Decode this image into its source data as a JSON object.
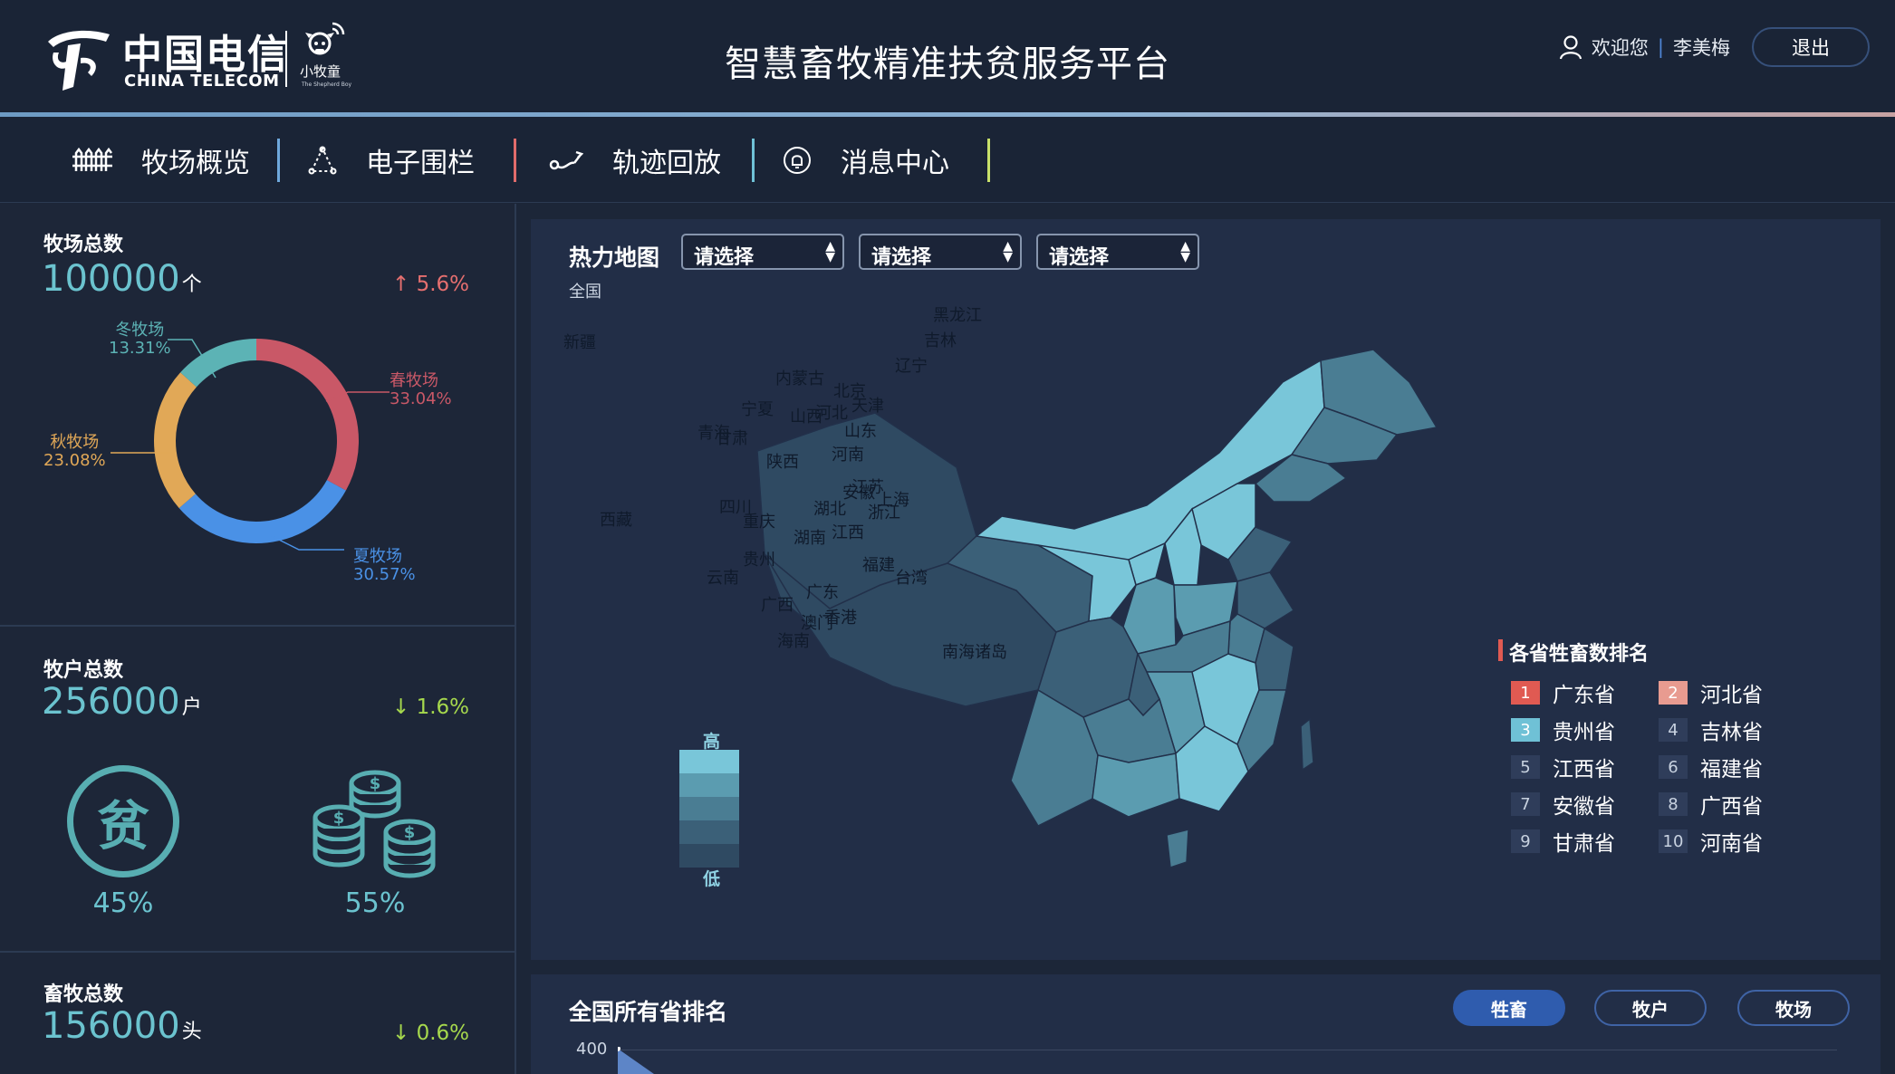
{
  "header": {
    "logo_cn": "中国电信",
    "logo_en": "CHINA TELECOM",
    "logo_sub": "小牧童",
    "logo_tiny": "The Shepherd Boy",
    "title": "智慧畜牧精准扶贫服务平台",
    "welcome": "欢迎您",
    "separator": "|",
    "username": "李美梅",
    "logout_label": "退出"
  },
  "nav": {
    "items": [
      {
        "label": "牧场概览",
        "icon": "fence-icon"
      },
      {
        "label": "电子围栏",
        "icon": "geofence-icon"
      },
      {
        "label": "轨迹回放",
        "icon": "track-icon"
      },
      {
        "label": "消息中心",
        "icon": "bell-icon"
      }
    ],
    "separator_colors": [
      "#6fa8dc",
      "#e16b6b",
      "#6fc1d6",
      "#c8e06a"
    ]
  },
  "stats": {
    "farms": {
      "label": "牧场总数",
      "value": "100000",
      "unit": "个",
      "trend_arrow": "↑",
      "trend": "5.6%",
      "trend_dir": "up",
      "segments": [
        {
          "name": "春牧场",
          "pct": "33.04%",
          "value": 33.04,
          "color": "#c95867"
        },
        {
          "name": "夏牧场",
          "pct": "30.57%",
          "value": 30.57,
          "color": "#4a91e6"
        },
        {
          "name": "秋牧场",
          "pct": "23.08%",
          "value": 23.08,
          "color": "#e1a857"
        },
        {
          "name": "冬牧场",
          "pct": "13.31%",
          "value": 13.31,
          "color": "#5cb3b5"
        }
      ]
    },
    "herders": {
      "label": "牧户总数",
      "value": "256000",
      "unit": "户",
      "trend_arrow": "↓",
      "trend": "1.6%",
      "trend_dir": "down",
      "poor_glyph": "贫",
      "poor_pct": "45%",
      "rich_pct": "55%",
      "coin_symbol": "$"
    },
    "livestock": {
      "label": "畜牧总数",
      "value": "156000",
      "unit": "头",
      "trend_arrow": "↓",
      "trend": "0.6%",
      "trend_dir": "down"
    }
  },
  "map": {
    "title": "热力地图",
    "selects": [
      "请选择",
      "请选择",
      "请选择"
    ],
    "scope": "全国",
    "legend_high": "高",
    "legend_low": "低",
    "legend_colors": [
      "#79c6d9",
      "#5b9cb0",
      "#4a7d93",
      "#3b6078",
      "#2f4a62"
    ],
    "provinces": [
      {
        "name": "黑龙江",
        "level": 2
      },
      {
        "name": "吉林",
        "level": 2
      },
      {
        "name": "辽宁",
        "level": 2
      },
      {
        "name": "内蒙古",
        "level": 0
      },
      {
        "name": "北京",
        "level": 4
      },
      {
        "name": "天津",
        "level": 4
      },
      {
        "name": "河北",
        "level": 0
      },
      {
        "name": "山西",
        "level": 0
      },
      {
        "name": "山东",
        "level": 3
      },
      {
        "name": "宁夏",
        "level": 0
      },
      {
        "name": "甘肃",
        "level": 0
      },
      {
        "name": "青海",
        "level": 3
      },
      {
        "name": "新疆",
        "level": 3
      },
      {
        "name": "西藏",
        "level": 4
      },
      {
        "name": "陕西",
        "level": 1
      },
      {
        "name": "河南",
        "level": 1
      },
      {
        "name": "江苏",
        "level": 3
      },
      {
        "name": "安徽",
        "level": 2
      },
      {
        "name": "上海",
        "level": 3
      },
      {
        "name": "湖北",
        "level": 2
      },
      {
        "name": "浙江",
        "level": 3
      },
      {
        "name": "四川",
        "level": 3
      },
      {
        "name": "重庆",
        "level": 3
      },
      {
        "name": "江西",
        "level": 0
      },
      {
        "name": "湖南",
        "level": 1
      },
      {
        "name": "贵州",
        "level": 2
      },
      {
        "name": "福建",
        "level": 2
      },
      {
        "name": "台湾",
        "level": 3
      },
      {
        "name": "云南",
        "level": 2
      },
      {
        "name": "广西",
        "level": 1
      },
      {
        "name": "广东",
        "level": 0
      },
      {
        "name": "澳门",
        "level": 3
      },
      {
        "name": "香港",
        "level": 3
      },
      {
        "name": "海南",
        "level": 2
      },
      {
        "name": "南海诸岛",
        "level": 3
      }
    ],
    "ranking": {
      "title": "各省牲畜数排名",
      "items": [
        {
          "rank": "1",
          "name": "广东省",
          "badge": "#e05a52"
        },
        {
          "rank": "2",
          "name": "河北省",
          "badge": "#e89b90"
        },
        {
          "rank": "3",
          "name": "贵州省",
          "badge": "#6fc1d6"
        },
        {
          "rank": "4",
          "name": "吉林省",
          "badge": "#2f3d5a"
        },
        {
          "rank": "5",
          "name": "江西省",
          "badge": "#2f3d5a"
        },
        {
          "rank": "6",
          "name": "福建省",
          "badge": "#2f3d5a"
        },
        {
          "rank": "7",
          "name": "安徽省",
          "badge": "#2f3d5a"
        },
        {
          "rank": "8",
          "name": "广西省",
          "badge": "#2f3d5a"
        },
        {
          "rank": "9",
          "name": "甘肃省",
          "badge": "#2f3d5a"
        },
        {
          "rank": "10",
          "name": "河南省",
          "badge": "#2f3d5a"
        }
      ]
    }
  },
  "bottom": {
    "title": "全国所有省排名",
    "tabs": [
      {
        "label": "牲畜",
        "active": true
      },
      {
        "label": "牧户",
        "active": false
      },
      {
        "label": "牧场",
        "active": false
      }
    ],
    "axis_top": "400"
  }
}
